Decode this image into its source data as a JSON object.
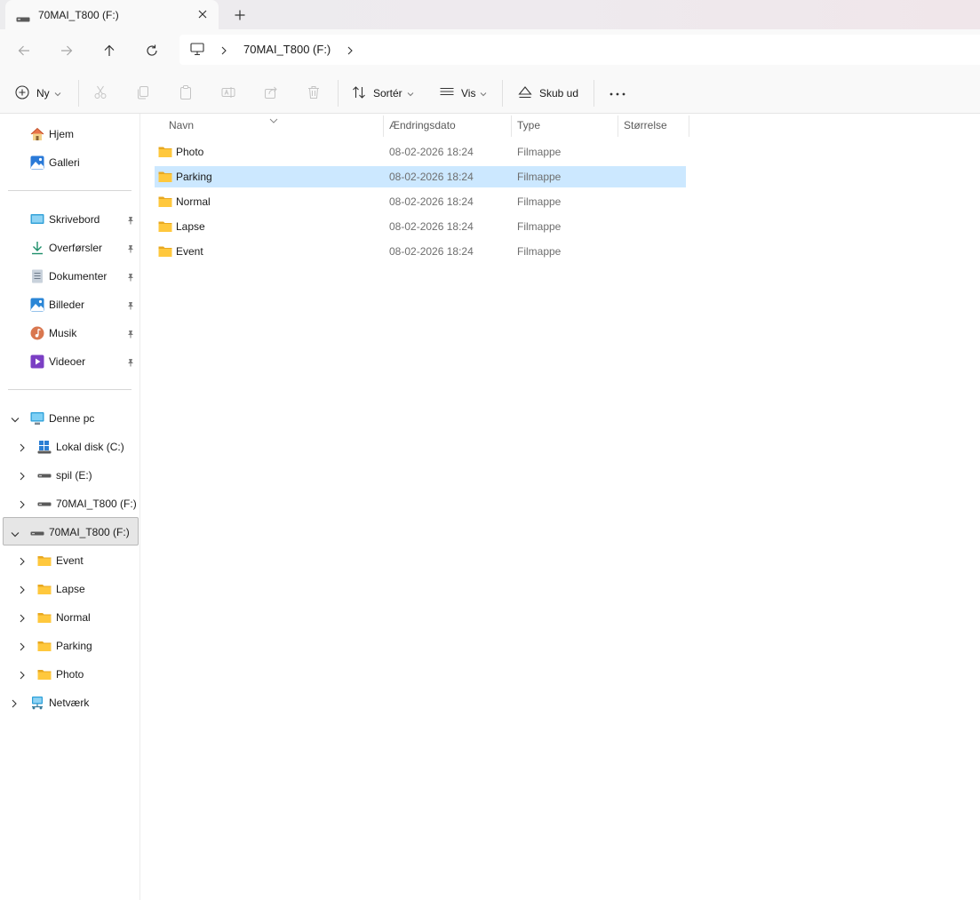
{
  "window": {
    "tab_title": "70MAI_T800 (F:)",
    "new_tab_glyph": "+",
    "close_tab_glyph": "×"
  },
  "address_bar": {
    "breadcrumb": [
      "70MAI_T800 (F:)"
    ],
    "root_icon": "computer-icon"
  },
  "command_bar": {
    "new_label": "Ny",
    "sort_label": "Sortér",
    "view_label": "Vis",
    "eject_label": "Skub ud",
    "more_glyph": "···"
  },
  "sidebar": {
    "home": "Hjem",
    "gallery": "Galleri",
    "quick_access": [
      {
        "label": "Skrivebord",
        "icon": "desktop-icon"
      },
      {
        "label": "Overførsler",
        "icon": "download-icon"
      },
      {
        "label": "Dokumenter",
        "icon": "documents-icon"
      },
      {
        "label": "Billeder",
        "icon": "pictures-icon"
      },
      {
        "label": "Musik",
        "icon": "music-icon"
      },
      {
        "label": "Videoer",
        "icon": "videos-icon"
      }
    ],
    "this_pc": "Denne pc",
    "pc_children": [
      "Lokal disk (C:)",
      "spil (E:)",
      "70MAI_T800 (F:)"
    ],
    "drive": "70MAI_T800 (F:)",
    "drive_children": [
      "Event",
      "Lapse",
      "Normal",
      "Parking",
      "Photo"
    ],
    "network": "Netværk"
  },
  "file_list": {
    "columns": [
      "Navn",
      "Ændringsdato",
      "Type",
      "Størrelse"
    ],
    "rows": [
      {
        "name": "Photo",
        "date": "08-02-2026 18:24",
        "type": "Filmappe",
        "size": ""
      },
      {
        "name": "Parking",
        "date": "08-02-2026 18:24",
        "type": "Filmappe",
        "size": ""
      },
      {
        "name": "Normal",
        "date": "08-02-2026 18:24",
        "type": "Filmappe",
        "size": ""
      },
      {
        "name": "Lapse",
        "date": "08-02-2026 18:24",
        "type": "Filmappe",
        "size": ""
      },
      {
        "name": "Event",
        "date": "08-02-2026 18:24",
        "type": "Filmappe",
        "size": ""
      }
    ],
    "selected_row": "Parking"
  },
  "colors": {
    "selection": "#cce8ff",
    "folder": "#ffc83d",
    "accent": "#0067c0"
  }
}
